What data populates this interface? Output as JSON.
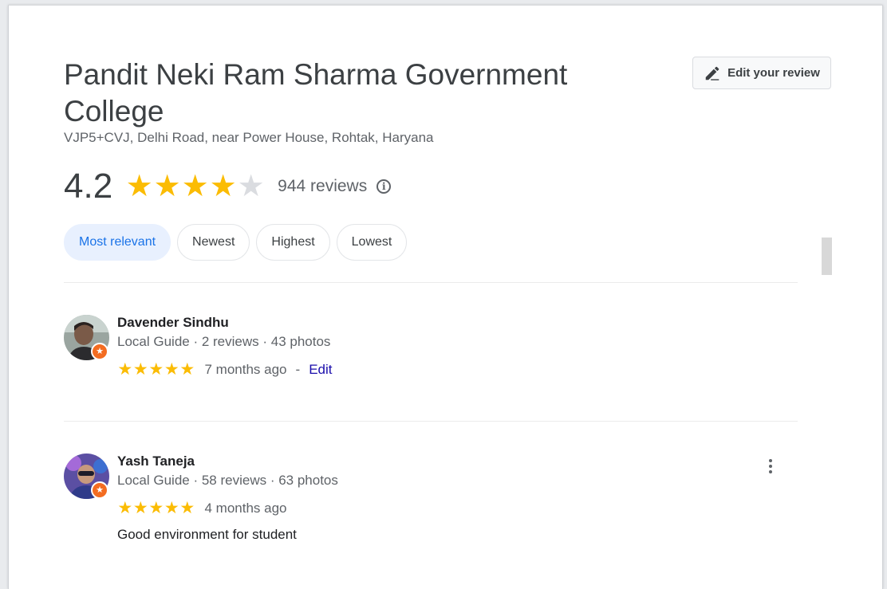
{
  "place": {
    "name": "Pandit Neki Ram Sharma Government College",
    "address": "VJP5+CVJ, Delhi Road, near Power House, Rohtak, Haryana",
    "rating": "4.2",
    "rating_value": 4.2,
    "review_count": "944 reviews"
  },
  "edit_review_label": "Edit your review",
  "sort_chips": [
    {
      "label": "Most relevant",
      "active": true
    },
    {
      "label": "Newest",
      "active": false
    },
    {
      "label": "Highest",
      "active": false
    },
    {
      "label": "Lowest",
      "active": false
    }
  ],
  "reviews": [
    {
      "name": "Davender Sindhu",
      "meta": "Local Guide · 2 reviews · 43 photos",
      "stars": 5,
      "time": "7 months ago",
      "separator": "-",
      "edit_label": "Edit",
      "text": ""
    },
    {
      "name": "Yash Taneja",
      "meta": "Local Guide · 58 reviews · 63 photos",
      "stars": 5,
      "time": "4 months ago",
      "separator": "",
      "edit_label": "",
      "text": "Good environment for student"
    }
  ],
  "colors": {
    "star": "#fbbc04",
    "star_empty": "#dadce0",
    "chip_active_bg": "#e8f0fe",
    "chip_active_text": "#1a73e8",
    "link": "#1a0dab",
    "badge": "#f36c21"
  },
  "icons": {
    "edit": "pencil-icon",
    "info": "info-icon",
    "more": "more-vert-icon",
    "star": "star-icon",
    "guide_badge": "local-guide-badge-icon"
  }
}
